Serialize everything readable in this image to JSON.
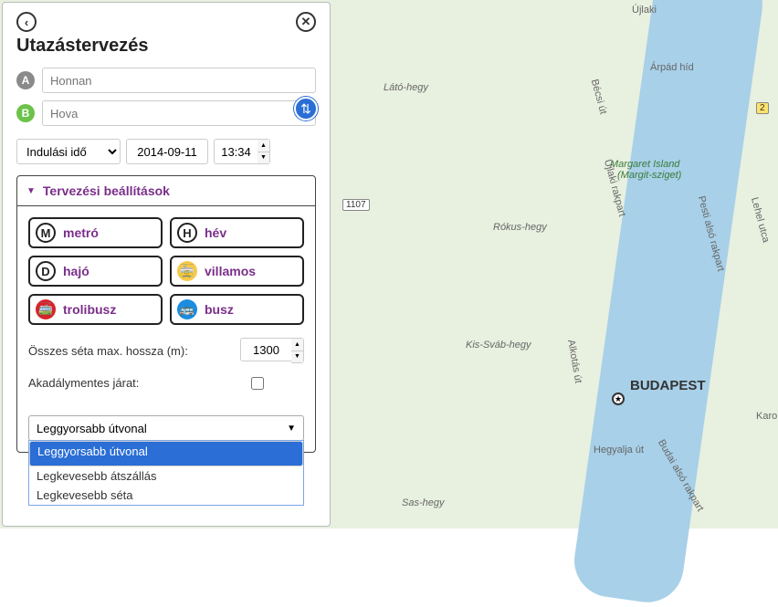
{
  "title": "Utazástervezés",
  "from_placeholder": "Honnan",
  "to_placeholder": "Hova",
  "time_mode": "Indulási idő",
  "date": "2014-09-11",
  "time": "13:34",
  "settings_header": "Tervezési beállítások",
  "modes": {
    "metro": "metró",
    "hev": "hév",
    "hajo": "hajó",
    "villamos": "villamos",
    "trolibusz": "trolibusz",
    "busz": "busz"
  },
  "walk_label": "Összes séta max. hossza (m):",
  "walk_value": "1300",
  "accessible_label": "Akadálymentes járat:",
  "route_option_selected": "Leggyorsabb útvonal",
  "route_options": {
    "o0": "Leggyorsabb útvonal",
    "o1": "Legkevesebb átszállás",
    "o2": "Legkevesebb séta"
  },
  "map": {
    "city": "BUDAPEST",
    "l1": "Látó-hegy",
    "l2": "Rókus-hegy",
    "l3": "Kis-Sváb-hegy",
    "l4": "Sas-hegy",
    "l5": "Margaret Island",
    "l5b": "(Margit-sziget)",
    "l6": "Árpád híd",
    "l7": "Hegyalja út",
    "l8": "Alkotás út",
    "l9": "Újlaki",
    "l10": "Bécsi út",
    "l11": "Újlaki rakpart",
    "l12": "Pesti alsó rakpart",
    "l13": "Lehel utca",
    "l14": "Karo",
    "l15": "Budai alsó rakpart",
    "r1": "1107",
    "r2": "1107",
    "r3": "2"
  }
}
